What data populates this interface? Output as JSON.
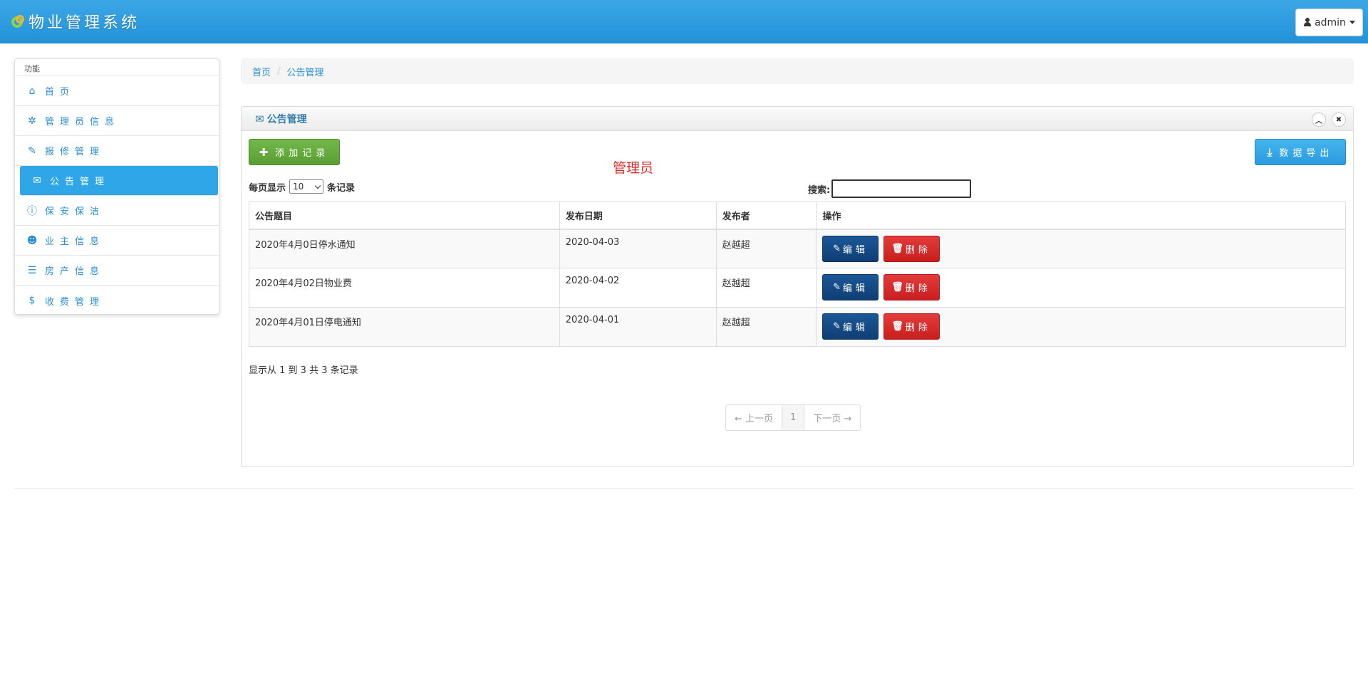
{
  "header": {
    "app_title": "物业管理系统",
    "user_label": "admin"
  },
  "sidebar": {
    "heading": "功能",
    "items": [
      {
        "label": "首页",
        "icon": "home-icon",
        "glyph": "⌂"
      },
      {
        "label": "管理员信息",
        "icon": "gear-icon",
        "glyph": "✲"
      },
      {
        "label": "报修管理",
        "icon": "wrench-icon",
        "glyph": "✎"
      },
      {
        "label": "公告管理",
        "icon": "envelope-icon",
        "glyph": "✉"
      },
      {
        "label": "保安保洁",
        "icon": "info-icon",
        "glyph": "ⓘ"
      },
      {
        "label": "业主信息",
        "icon": "user-icon",
        "glyph": "☻"
      },
      {
        "label": "房产信息",
        "icon": "list-icon",
        "glyph": "☰"
      },
      {
        "label": "收费管理",
        "icon": "dollar-icon",
        "glyph": "$"
      }
    ]
  },
  "breadcrumb": {
    "home": "首页",
    "current": "公告管理"
  },
  "panel": {
    "title": "公告管理",
    "add_button": "添加记录",
    "export_button": "数据导出",
    "role_label": "管理员",
    "length_prefix": "每页显示",
    "length_value": "10",
    "length_suffix": "条记录",
    "search_label": "搜索:",
    "search_value": ""
  },
  "table": {
    "columns": [
      "公告题目",
      "发布日期",
      "发布者",
      "操作"
    ],
    "rows": [
      {
        "title": "2020年4月0日停水通知",
        "date": "2020-04-03",
        "author": "赵越超"
      },
      {
        "title": "2020年4月02日物业费",
        "date": "2020-04-02",
        "author": "赵越超"
      },
      {
        "title": "2020年4月01日停电通知",
        "date": "2020-04-01",
        "author": "赵越超"
      }
    ],
    "edit_label": "编辑",
    "delete_label": "删除"
  },
  "info_text": "显示从 1 到 3 共 3 条记录",
  "pagination": {
    "prev": "← 上一页",
    "current": "1",
    "next": "下一页 →"
  }
}
